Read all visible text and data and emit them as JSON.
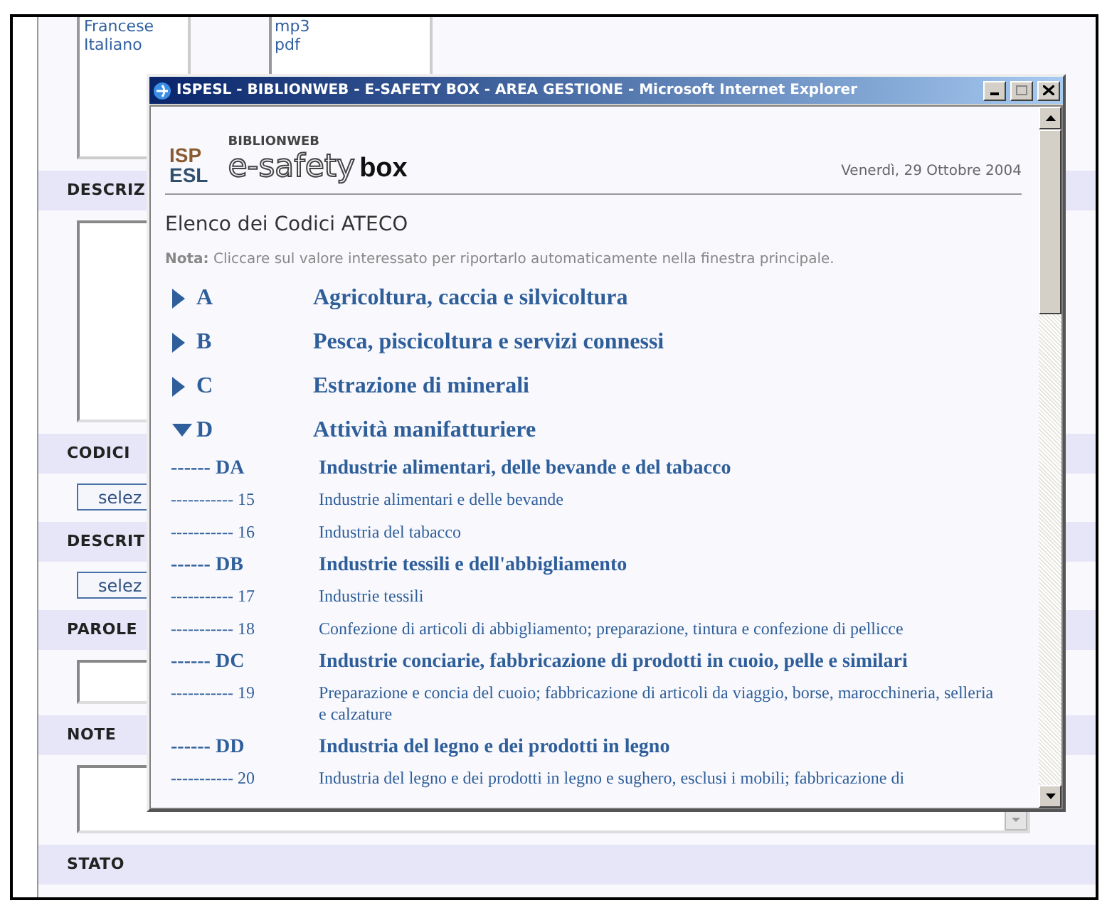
{
  "page": {
    "listbox_1": [
      "Francese",
      "Italiano"
    ],
    "listbox_2": [
      "mp3",
      "pdf"
    ],
    "sections": [
      {
        "kind": "textarea",
        "label": "DESCRIZ"
      },
      {
        "kind": "button",
        "label": "CODICI",
        "button": "selez"
      },
      {
        "kind": "button",
        "label": "DESCRIT",
        "button": "selez"
      },
      {
        "kind": "input",
        "label": "PAROLE"
      },
      {
        "kind": "scroll-textarea",
        "label": "NOTE"
      },
      {
        "kind": "bar",
        "label": "STATO"
      }
    ]
  },
  "popup": {
    "title": "ISPESL - BIBLIONWEB - E-SAFETY BOX - AREA GESTIONE - Microsoft Internet Explorer",
    "logo": {
      "top": "ISP",
      "bottom": "ESL",
      "brand_small": "BIBLIONWEB",
      "brand_outline": "e-safety",
      "brand_bold": "box"
    },
    "date": "Venerdì, 29 Ottobre 2004",
    "heading": "Elenco dei Codici ATECO",
    "note": "**Nota:** Cliccare sul valore interessato per riportarlo automaticamente nella finestra principale.",
    "sections": [
      {
        "code": "A",
        "title": "Agricoltura, caccia e silvicoltura",
        "expanded": false
      },
      {
        "code": "B",
        "title": "Pesca, piscicoltura e servizi connessi",
        "expanded": false
      },
      {
        "code": "C",
        "title": "Estrazione di minerali",
        "expanded": false
      },
      {
        "code": "D",
        "title": "Attività manifatturiere",
        "expanded": true,
        "children": [
          {
            "code": "------ DA",
            "title": "Industrie alimentari, delle bevande e del tabacco",
            "children": [
              {
                "code": "----------- 15",
                "title": "Industrie alimentari e delle bevande"
              },
              {
                "code": "----------- 16",
                "title": "Industria del tabacco"
              }
            ]
          },
          {
            "code": "------ DB",
            "title": "Industrie tessili e dell'abbigliamento",
            "children": [
              {
                "code": "----------- 17",
                "title": "Industrie tessili"
              },
              {
                "code": "----------- 18",
                "title": "Confezione di articoli di abbigliamento; preparazione, tintura e confezione di pellicce"
              }
            ]
          },
          {
            "code": "------ DC",
            "title": "Industrie conciarie, fabbricazione di prodotti in cuoio, pelle e similari",
            "children": [
              {
                "code": "----------- 19",
                "title": "Preparazione e concia del cuoio; fabbricazione di articoli da viaggio, borse, marocchineria, selleria e calzature"
              }
            ]
          },
          {
            "code": "------ DD",
            "title": "Industria del legno e dei prodotti in legno",
            "children": [
              {
                "code": "----------- 20",
                "title": "Industria del legno e dei prodotti in legno e sughero, esclusi i mobili; fabbricazione di"
              }
            ]
          }
        ]
      }
    ]
  }
}
